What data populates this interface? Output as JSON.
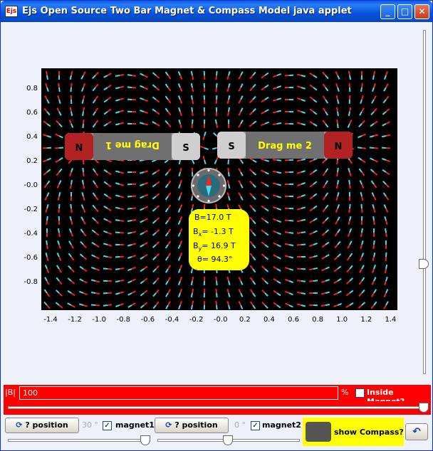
{
  "window": {
    "title": "Ejs Open Source Two Bar Magnet & Compass Model java applet",
    "icon_text": "Ejs",
    "minimize_icon": "minimize-icon",
    "maximize_icon": "maximize-icon",
    "close_icon": "close-icon"
  },
  "plot": {
    "y_ticks": [
      "0.8",
      "0.6",
      "0.4",
      "0.2",
      "-0.0",
      "-0.2",
      "-0.4",
      "-0.6",
      "-0.8"
    ],
    "x_ticks": [
      "-1.4",
      "-1.2",
      "-1.0",
      "-0.8",
      "-0.6",
      "-0.4",
      "-0.2",
      "-0.0",
      "0.2",
      "0.4",
      "0.6",
      "0.8",
      "1.0",
      "1.2",
      "1.4"
    ],
    "background": "#000000",
    "arrow_colors": {
      "head": "#ff2020",
      "tail": "#40e0f0"
    }
  },
  "magnet1": {
    "north": "N",
    "south": "S",
    "label": "Drag me 1"
  },
  "magnet2": {
    "south": "S",
    "north": "N",
    "label": "Drag me 2"
  },
  "readout": {
    "b_total": "B=17.0 T",
    "bx_prefix": "B",
    "bx_sub": "x",
    "bx_value": "= -1.3 T",
    "by_prefix": "B",
    "by_sub": "y",
    "by_value": "= 16.9 T",
    "theta": "θ= 94.3°"
  },
  "field_bar": {
    "label": "|B|",
    "value": "100",
    "unit": "%",
    "inside_magnet_label": "Inside Magnet?",
    "inside_magnet_checked": false
  },
  "controls": {
    "position1_label": "? position",
    "angle1": "30 °",
    "magnet1_label": "magnet1",
    "magnet1_checked": true,
    "position2_label": "? position",
    "angle2": "0 °",
    "magnet2_label": "magnet2",
    "magnet2_checked": true,
    "show_compass_label": "show Compass?",
    "reset_icon": "reset-icon"
  },
  "colors": {
    "accent_red": "#ff0000",
    "readout_yellow": "#ffff00",
    "title_blue": "#0553d9"
  }
}
